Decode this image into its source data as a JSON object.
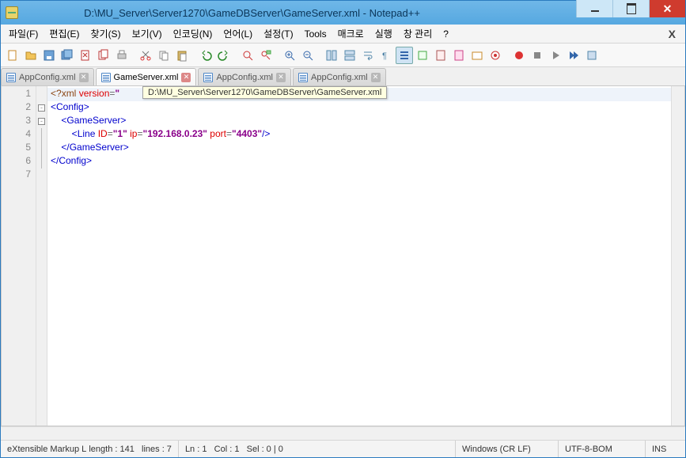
{
  "title": "D:\\MU_Server\\Server1270\\GameDBServer\\GameServer.xml - Notepad++",
  "menu": {
    "file": "파일(F)",
    "edit": "편집(E)",
    "search": "찾기(S)",
    "view": "보기(V)",
    "encoding": "인코딩(N)",
    "lang": "언어(L)",
    "settings": "설정(T)",
    "tools": "Tools",
    "macro": "매크로",
    "run": "실행",
    "window": "창 관리",
    "help": "?"
  },
  "tabs": [
    {
      "label": "AppConfig.xml",
      "active": false
    },
    {
      "label": "GameServer.xml",
      "active": true
    },
    {
      "label": "AppConfig.xml",
      "active": false
    },
    {
      "label": "AppConfig.xml",
      "active": false
    }
  ],
  "tooltip": "D:\\MU_Server\\Server1270\\GameDBServer\\GameServer.xml",
  "code": {
    "lines": [
      {
        "n": 1,
        "seg": [
          [
            "<?",
            "pi"
          ],
          [
            "xml ",
            "pi"
          ],
          [
            "version",
            "attr"
          ],
          [
            "=",
            "punc"
          ],
          [
            "\"",
            "val"
          ]
        ]
      },
      {
        "n": 2,
        "seg": [
          [
            "<",
            "tag"
          ],
          [
            "Config",
            "tag"
          ],
          [
            ">",
            "tag"
          ]
        ]
      },
      {
        "n": 3,
        "seg": [
          [
            "    ",
            "x"
          ],
          [
            "<",
            "tag"
          ],
          [
            "GameServer",
            "tag"
          ],
          [
            ">",
            "tag"
          ]
        ]
      },
      {
        "n": 4,
        "seg": [
          [
            "        ",
            "x"
          ],
          [
            "<",
            "tag"
          ],
          [
            "Line ",
            "tag"
          ],
          [
            "ID",
            "attr"
          ],
          [
            "=",
            "punc"
          ],
          [
            "\"1\"",
            "val"
          ],
          [
            " ",
            "x"
          ],
          [
            "ip",
            "attr"
          ],
          [
            "=",
            "punc"
          ],
          [
            "\"192.168.0.23\"",
            "val"
          ],
          [
            " ",
            "x"
          ],
          [
            "port",
            "attr"
          ],
          [
            "=",
            "punc"
          ],
          [
            "\"4403\"",
            "val"
          ],
          [
            "/>",
            "tag"
          ]
        ]
      },
      {
        "n": 5,
        "seg": [
          [
            "    ",
            "x"
          ],
          [
            "</",
            "tag"
          ],
          [
            "GameServer",
            "tag"
          ],
          [
            ">",
            "tag"
          ]
        ]
      },
      {
        "n": 6,
        "seg": [
          [
            "</",
            "tag"
          ],
          [
            "Config",
            "tag"
          ],
          [
            ">",
            "tag"
          ]
        ]
      },
      {
        "n": 7,
        "seg": []
      }
    ]
  },
  "status": {
    "lang": "eXtensible Markup L",
    "length": "length : 141",
    "lines": "lines : 7",
    "ln": "Ln : 1",
    "col": "Col : 1",
    "sel": "Sel : 0 | 0",
    "eol": "Windows (CR LF)",
    "enc": "UTF-8-BOM",
    "ins": "INS"
  }
}
